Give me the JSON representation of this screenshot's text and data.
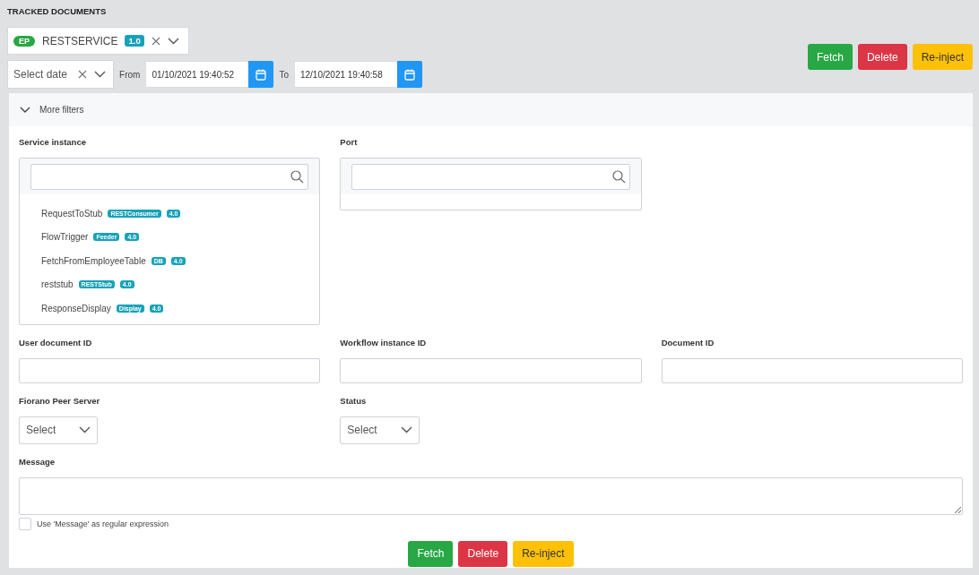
{
  "title": "TRACKED DOCUMENTS",
  "application": {
    "badge": "EP",
    "name": "RESTSERVICE",
    "version": "1.0"
  },
  "date_filter": {
    "placeholder": "Select date",
    "from_label": "From",
    "from_value": "01/10/2021 19:40:52",
    "to_label": "To",
    "to_value": "12/10/2021 19:40:58"
  },
  "top_buttons": [
    {
      "label": "Fetch",
      "kind": "success"
    },
    {
      "label": "Delete",
      "kind": "danger"
    },
    {
      "label": "Re-inject",
      "kind": "warning"
    }
  ],
  "more_filters": {
    "label": "More filters",
    "expanded": true
  },
  "service_instance": {
    "label": "Service instance",
    "items": [
      {
        "name": "RequestToStub",
        "type": "RESTConsumer",
        "version": "4.0"
      },
      {
        "name": "FlowTrigger",
        "type": "Feeder",
        "version": "4.0"
      },
      {
        "name": "FetchFromEmployeeTable",
        "type": "DB",
        "version": "4.0"
      },
      {
        "name": "reststub",
        "type": "RESTStub",
        "version": "4.0"
      },
      {
        "name": "ResponseDisplay",
        "type": "Display",
        "version": "4.0"
      }
    ]
  },
  "port": {
    "label": "Port"
  },
  "id_fields": [
    {
      "label": "User document ID"
    },
    {
      "label": "Workflow instance ID"
    },
    {
      "label": "Document ID"
    }
  ],
  "selects": [
    {
      "label": "Fiorano Peer Server",
      "placeholder": "Select"
    },
    {
      "label": "Status",
      "placeholder": "Select"
    }
  ],
  "message": {
    "label": "Message"
  },
  "regex_option": {
    "label": "Use 'Message' as regular expression",
    "checked": false
  },
  "bottom_buttons": [
    {
      "label": "Fetch",
      "kind": "success"
    },
    {
      "label": "Delete",
      "kind": "danger"
    },
    {
      "label": "Re-inject",
      "kind": "warning"
    }
  ]
}
